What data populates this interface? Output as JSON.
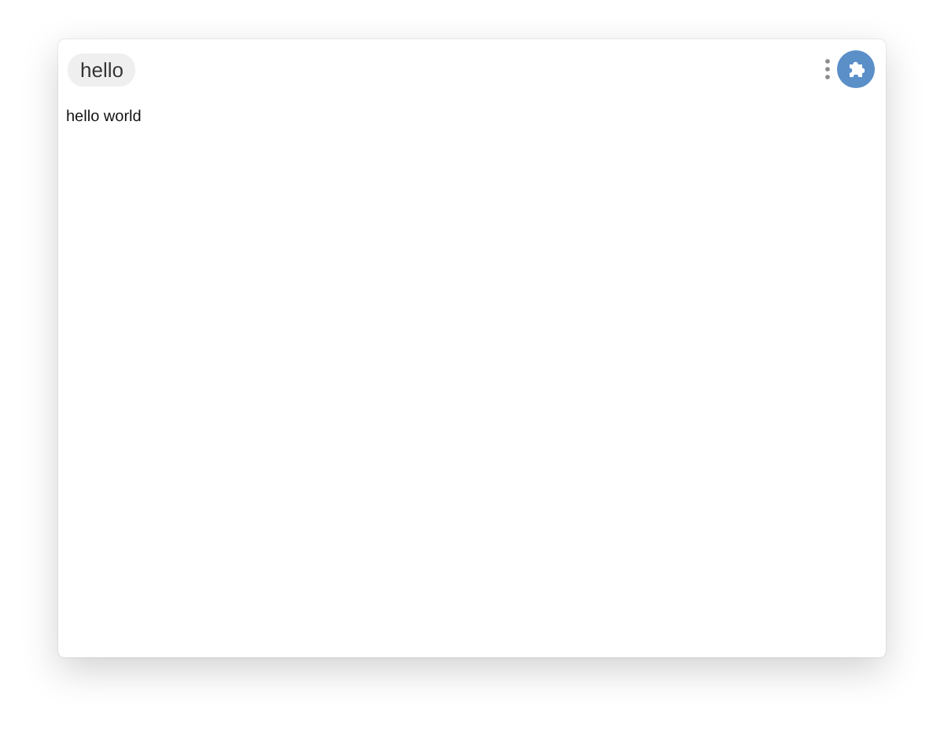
{
  "header": {
    "chip": "hello"
  },
  "content": {
    "text": "hello world"
  }
}
